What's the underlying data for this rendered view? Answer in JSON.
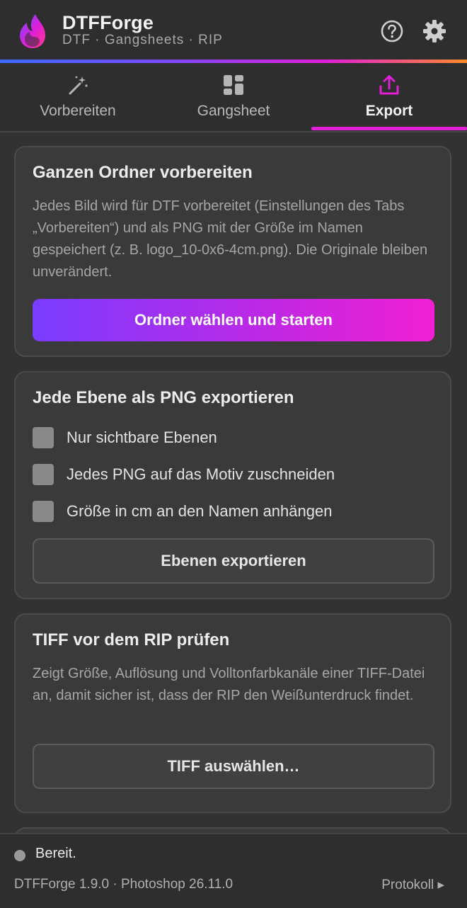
{
  "header": {
    "title": "DTFForge",
    "subtitle": "DTF · Gangsheets · RIP",
    "icons": {
      "logo": "flame-logo-icon",
      "help": "help-icon",
      "settings": "gear-icon"
    }
  },
  "tabs": [
    {
      "label": "Vorbereiten",
      "icon": "magic-wand-icon",
      "active": false
    },
    {
      "label": "Gangsheet",
      "icon": "grid-layout-icon",
      "active": false
    },
    {
      "label": "Export",
      "icon": "export-upload-icon",
      "active": true
    }
  ],
  "cards": {
    "prepare_folder": {
      "title": "Ganzen Ordner vorbereiten",
      "description": "Jedes Bild wird für DTF vorbereitet (Einstellungen des Tabs „Vorbereiten“) und als PNG mit der Größe im Namen gespeichert (z. B. logo_10-0x6-4cm.png). Die Originale bleiben unverändert.",
      "button": "Ordner wählen und starten"
    },
    "layers_png": {
      "title": "Jede Ebene als PNG exportieren",
      "options": [
        {
          "label": "Nur sichtbare Ebenen",
          "checked": false
        },
        {
          "label": "Jedes PNG auf das Motiv zuschneiden",
          "checked": false
        },
        {
          "label": "Größe in cm an den Namen anhängen",
          "checked": false
        }
      ],
      "button": "Ebenen exportieren"
    },
    "tiff_check": {
      "title": "TIFF vor dem RIP prüfen",
      "description": "Zeigt Größe, Auflösung und Volltonfarbkanäle einer TIFF-Datei an, damit sicher ist, dass der RIP den Weißunterdruck findet.",
      "button": "TIFF auswählen…"
    }
  },
  "footer": {
    "status": "Bereit.",
    "version": "DTFForge 1.9.0 · Photoshop 26.11.0",
    "log_link": "Protokoll ▸"
  },
  "colors": {
    "accent_magenta": "#e11fd7",
    "accent_violet": "#7a3cff",
    "background": "#323232"
  }
}
